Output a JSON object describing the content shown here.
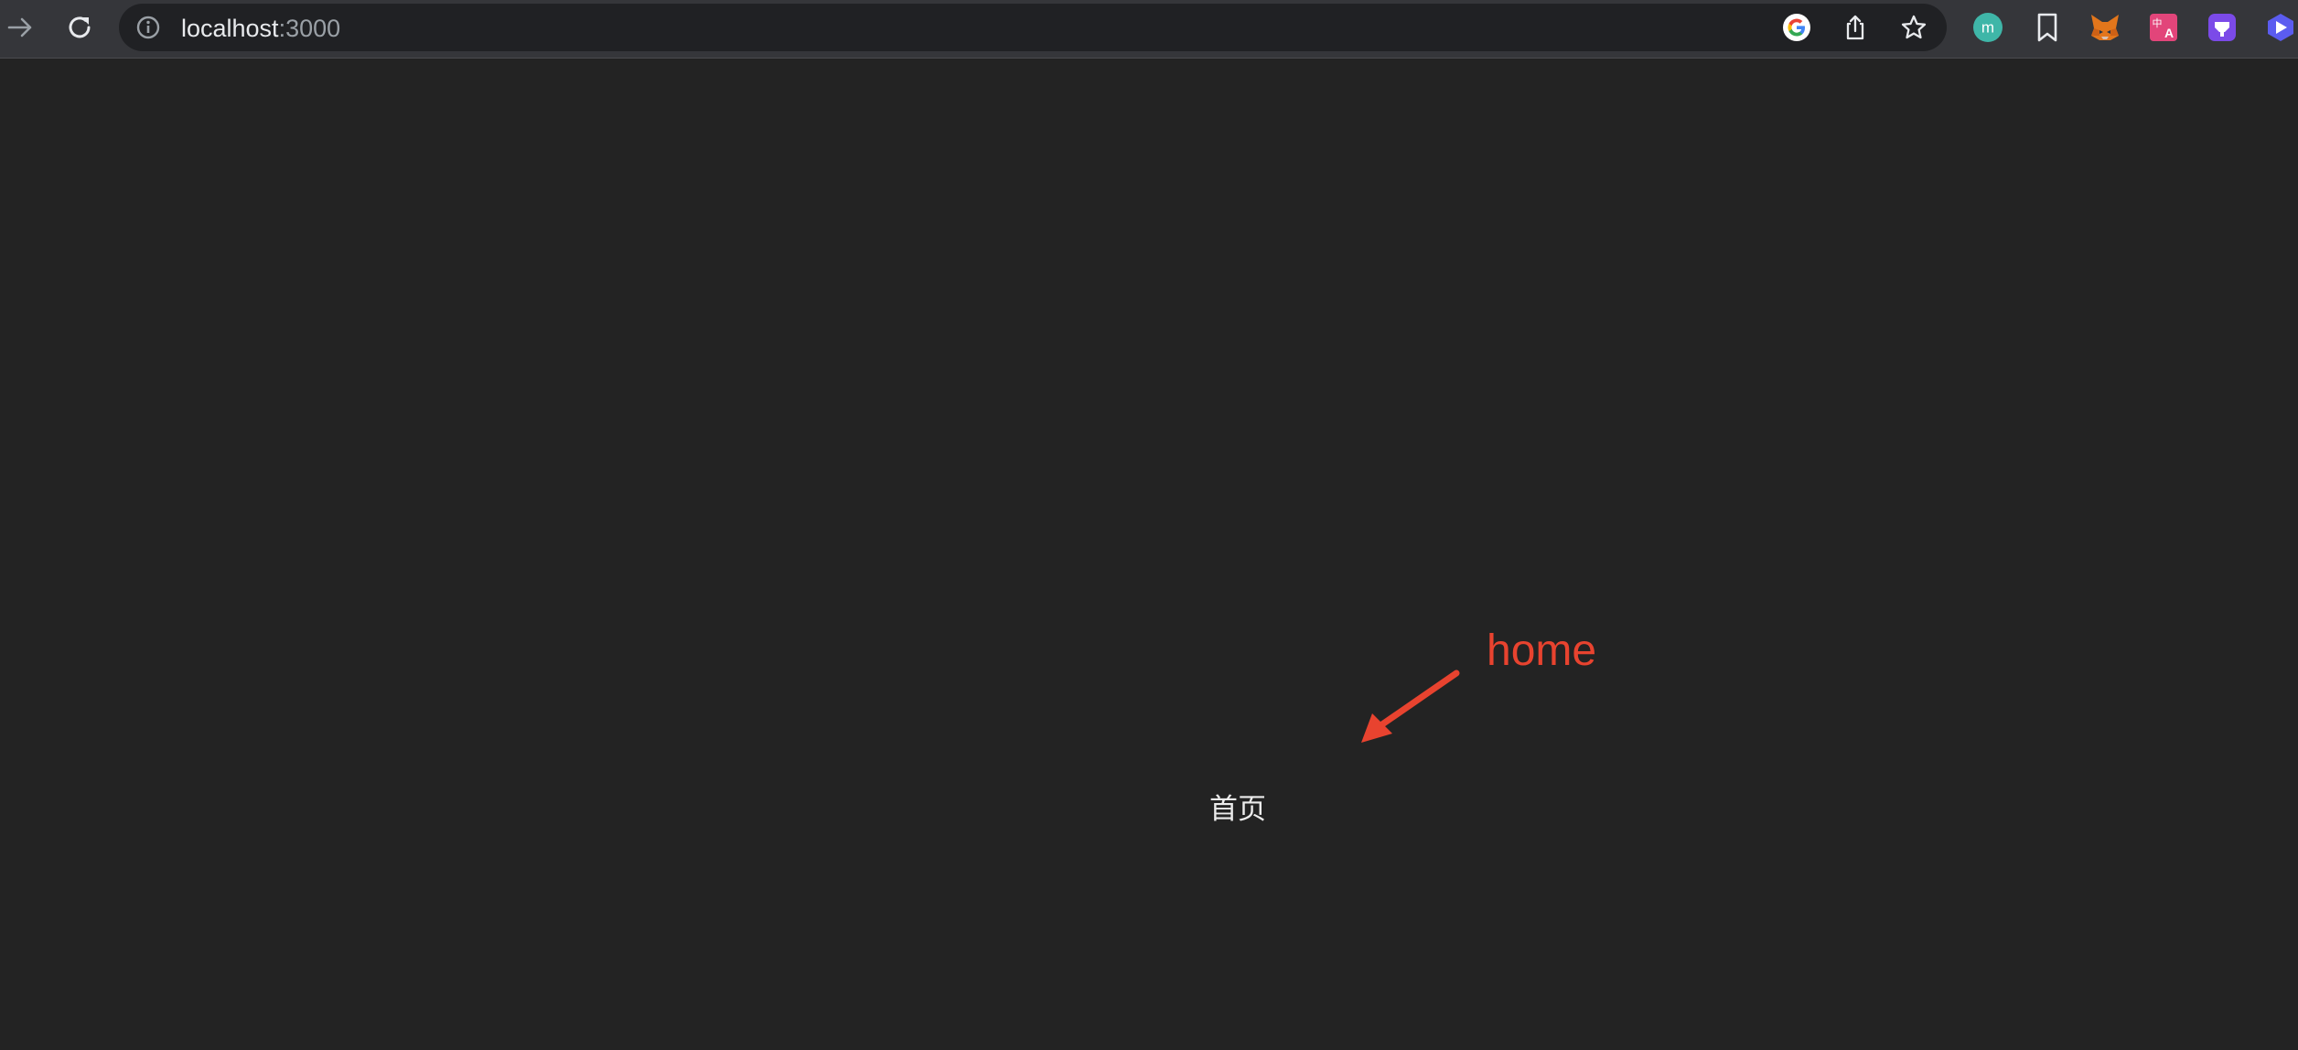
{
  "browser": {
    "url_host": "localhost",
    "url_port": ":3000",
    "icons": {
      "forward": "arrow-right-icon",
      "reload": "reload-icon",
      "site_info": "info-icon",
      "google": "google-g-icon",
      "share": "share-icon",
      "bookmark_star": "star-icon"
    },
    "extensions": [
      {
        "name": "m-extension-icon",
        "letter": "m",
        "color": "#3fb6a8"
      },
      {
        "name": "bookmark-icon",
        "color": "#e8eaed"
      },
      {
        "name": "metamask-fox-icon",
        "color": "#e2761b"
      },
      {
        "name": "translate-icon",
        "color": "#e2457a"
      },
      {
        "name": "purple-extension-icon",
        "color": "#7b4ae8"
      },
      {
        "name": "blue-extension-icon",
        "color": "#5b5cf0"
      }
    ]
  },
  "page": {
    "home_link": "首页"
  },
  "annotation": {
    "label": "home",
    "color": "#e8432f"
  }
}
